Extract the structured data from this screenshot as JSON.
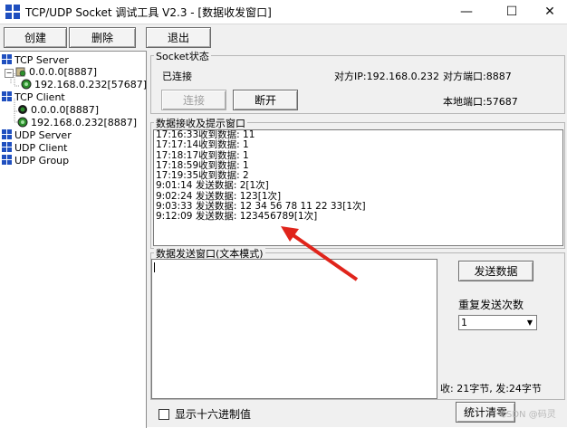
{
  "window": {
    "title": "TCP/UDP Socket 调试工具 V2.3 - [数据收发窗口]",
    "minimize_glyph": "—",
    "maximize_glyph": "☐",
    "close_glyph": "✕"
  },
  "toolbar": {
    "create_label": "创建",
    "delete_label": "删除",
    "exit_label": "退出"
  },
  "tree": {
    "tcp_server": "TCP Server",
    "tcp_server_listen": "0.0.0.0[8887]",
    "tcp_server_conn": "192.168.0.232[57687]",
    "tcp_client": "TCP Client",
    "tcp_client_a": "0.0.0.0[8887]",
    "tcp_client_b": "192.168.0.232[8887]",
    "udp_server": "UDP Server",
    "udp_client": "UDP Client",
    "udp_group": "UDP Group"
  },
  "socket_status": {
    "group_label": "Socket状态",
    "state": "已连接",
    "peer_ip": "对方IP:192.168.0.232",
    "peer_port": "对方端口:8887",
    "local_port": "本地端口:57687",
    "connect_label": "连接",
    "disconnect_label": "断开"
  },
  "receive": {
    "group_label": "数据接收及提示窗口",
    "lines": [
      "17:16:33收到数据: 11",
      "17:17:14收到数据: 1",
      "17:18:17收到数据: 1",
      "17:18:59收到数据: 1",
      "17:19:35收到数据: 2",
      "9:01:14 发送数据: 2[1次]",
      "9:02:24 发送数据: 123[1次]",
      "9:03:33 发送数据: 12 34 56 78 11 22 33[1次]",
      "9:12:09 发送数据: 123456789[1次]"
    ]
  },
  "send": {
    "group_label": "数据发送窗口(文本模式)",
    "value": "",
    "send_button": "发送数据",
    "repeat_label": "重复发送次数",
    "repeat_value": "1",
    "stats": "收: 21字节, 发:24字节",
    "hex_label": "显示十六进制值",
    "clear_button": "统计清零"
  },
  "watermark": "CSDN @码灵",
  "colors": {
    "annotation_arrow": "#e0241b",
    "icon_blue": "#1f4fbf",
    "icon_green": "#2c8f2c"
  }
}
